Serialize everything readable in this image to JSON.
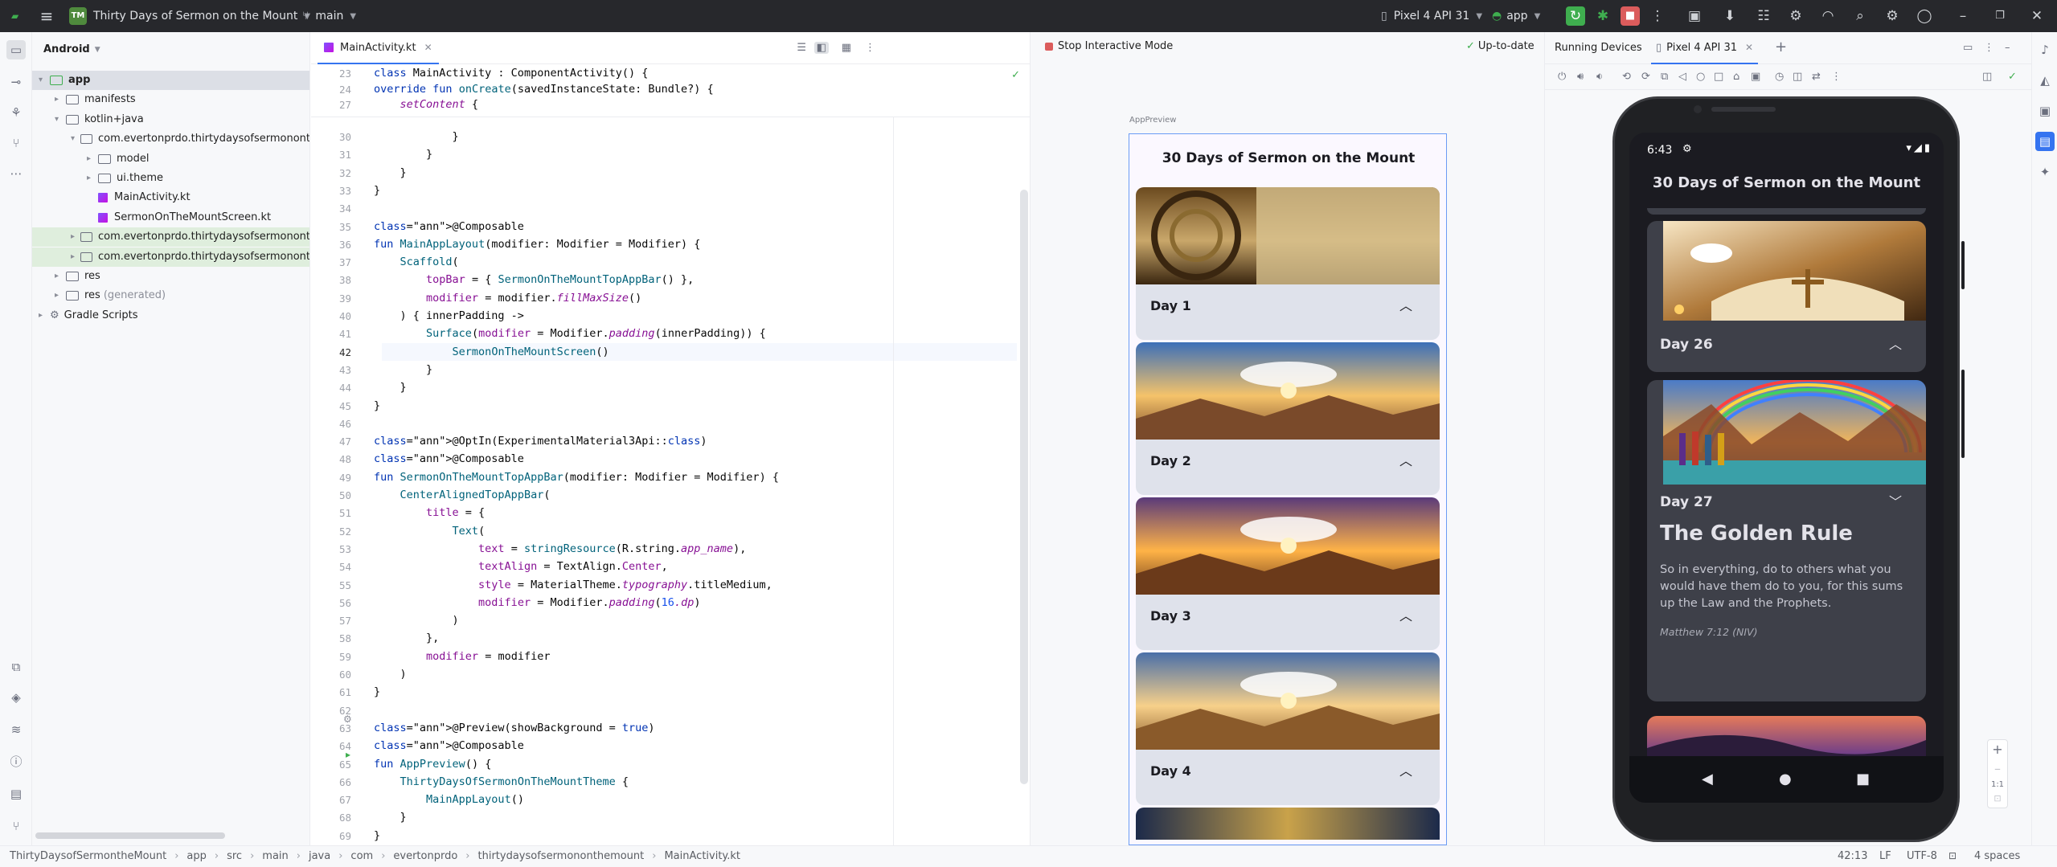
{
  "titlebar": {
    "project_badge": "TM",
    "project_name": "Thirty Days of Sermon on the Mount",
    "branch": "main",
    "device": "Pixel 4 API 31",
    "run_config": "app"
  },
  "project_panel": {
    "view_mode": "Android",
    "tree": [
      {
        "label": "app",
        "type": "folder",
        "depth": 0,
        "open": true,
        "selected": true
      },
      {
        "label": "manifests",
        "type": "folder",
        "depth": 1,
        "open": false
      },
      {
        "label": "kotlin+java",
        "type": "folder",
        "depth": 1,
        "open": true
      },
      {
        "label": "com.evertonprdo.thirtydaysofsermonont",
        "type": "package",
        "depth": 2,
        "open": true
      },
      {
        "label": "model",
        "type": "package",
        "depth": 3,
        "open": false
      },
      {
        "label": "ui.theme",
        "type": "package",
        "depth": 3,
        "open": false
      },
      {
        "label": "MainActivity.kt",
        "type": "kotlin",
        "depth": 3
      },
      {
        "label": "SermonOnTheMountScreen.kt",
        "type": "kotlin",
        "depth": 3
      },
      {
        "label": "com.evertonprdo.thirtydaysofsermonont",
        "type": "package",
        "depth": 2,
        "open": false,
        "highlight": true
      },
      {
        "label": "com.evertonprdo.thirtydaysofsermonont",
        "type": "package",
        "depth": 2,
        "open": false,
        "highlight": true
      },
      {
        "label": "res",
        "type": "folder",
        "depth": 1,
        "open": false
      },
      {
        "label": "res",
        "suffix": "(generated)",
        "type": "folder",
        "depth": 1,
        "open": false
      },
      {
        "label": "Gradle Scripts",
        "type": "gradle",
        "depth": 0,
        "open": false
      }
    ]
  },
  "editor": {
    "tab": "MainActivity.kt",
    "sticky_lines": [
      {
        "n": "23",
        "code": "class MainActivity : ComponentActivity() {"
      },
      {
        "n": "24",
        "code": "    override fun onCreate(savedInstanceState: Bundle?) {"
      },
      {
        "n": "27",
        "code": "        setContent {"
      }
    ],
    "lines": [
      {
        "n": "30",
        "code": "                }"
      },
      {
        "n": "31",
        "code": "            }"
      },
      {
        "n": "32",
        "code": "        }"
      },
      {
        "n": "33",
        "code": "    }"
      },
      {
        "n": "34",
        "code": ""
      },
      {
        "n": "35",
        "code": "    @Composable"
      },
      {
        "n": "36",
        "code": "    fun MainAppLayout(modifier: Modifier = Modifier) {"
      },
      {
        "n": "37",
        "code": "        Scaffold("
      },
      {
        "n": "38",
        "code": "            topBar = { SermonOnTheMountTopAppBar() },"
      },
      {
        "n": "39",
        "code": "            modifier = modifier.fillMaxSize()"
      },
      {
        "n": "40",
        "code": "        ) { innerPadding ->"
      },
      {
        "n": "41",
        "code": "            Surface(modifier = Modifier.padding(innerPadding)) {"
      },
      {
        "n": "42",
        "code": "                SermonOnTheMountScreen()"
      },
      {
        "n": "43",
        "code": "            }"
      },
      {
        "n": "44",
        "code": "        }"
      },
      {
        "n": "45",
        "code": "    }"
      },
      {
        "n": "46",
        "code": ""
      },
      {
        "n": "47",
        "code": "    @OptIn(ExperimentalMaterial3Api::class)"
      },
      {
        "n": "48",
        "code": "    @Composable"
      },
      {
        "n": "49",
        "code": "    fun SermonOnTheMountTopAppBar(modifier: Modifier = Modifier) {"
      },
      {
        "n": "50",
        "code": "        CenterAlignedTopAppBar("
      },
      {
        "n": "51",
        "code": "            title = {"
      },
      {
        "n": "52",
        "code": "                Text("
      },
      {
        "n": "53",
        "code": "                    text = stringResource(R.string.app_name),"
      },
      {
        "n": "54",
        "code": "                    textAlign = TextAlign.Center,"
      },
      {
        "n": "55",
        "code": "                    style = MaterialTheme.typography.titleMedium,"
      },
      {
        "n": "56",
        "code": "                    modifier = Modifier.padding(16.dp)"
      },
      {
        "n": "57",
        "code": "                )"
      },
      {
        "n": "58",
        "code": "            },"
      },
      {
        "n": "59",
        "code": "            modifier = modifier"
      },
      {
        "n": "60",
        "code": "        )"
      },
      {
        "n": "61",
        "code": "    }"
      },
      {
        "n": "62",
        "code": ""
      },
      {
        "n": "63",
        "code": "    @Preview(showBackground = true)"
      },
      {
        "n": "64",
        "code": "    @Composable"
      },
      {
        "n": "65",
        "code": "    fun AppPreview() {"
      },
      {
        "n": "66",
        "code": "        ThirtyDaysOfSermonOnTheMountTheme {"
      },
      {
        "n": "67",
        "code": "            MainAppLayout()"
      },
      {
        "n": "68",
        "code": "        }"
      },
      {
        "n": "69",
        "code": "    }"
      }
    ]
  },
  "preview": {
    "stop_label": "Stop Interactive Mode",
    "status": "Up-to-date",
    "preview_name": "AppPreview",
    "app_title": "30 Days of Sermon on the Mount",
    "days": [
      "Day 1",
      "Day 2",
      "Day 3",
      "Day 4"
    ]
  },
  "running_devices": {
    "panel_title": "Running Devices",
    "device_tab": "Pixel 4 API 31",
    "time": "6:43",
    "app_title": "30 Days of Sermon on the Mount",
    "day26": "Day 26",
    "day27": "Day 27",
    "verse_title": "The Golden Rule",
    "verse_text": "So in everything, do to others what you would have them do to you, for this sums up the Law and the Prophets.",
    "verse_ref": "Matthew 7:12 (NIV)",
    "zoom_fit": "1:1"
  },
  "statusbar": {
    "breadcrumbs": [
      "ThirtyDaysofSermontheMount",
      "app",
      "src",
      "main",
      "java",
      "com",
      "evertonprdo",
      "thirtydaysofsermononthemount",
      "MainActivity.kt"
    ],
    "position": "42:13",
    "line_sep": "LF",
    "encoding": "UTF-8",
    "indent": "4 spaces"
  },
  "colors": {
    "titlebar_bg": "#27282c",
    "accent": "#3574f0",
    "run_green": "#3fae4f",
    "stop_red": "#db5c5c",
    "phone_bg": "#1b1b21",
    "card_dark": "#3e4049"
  }
}
